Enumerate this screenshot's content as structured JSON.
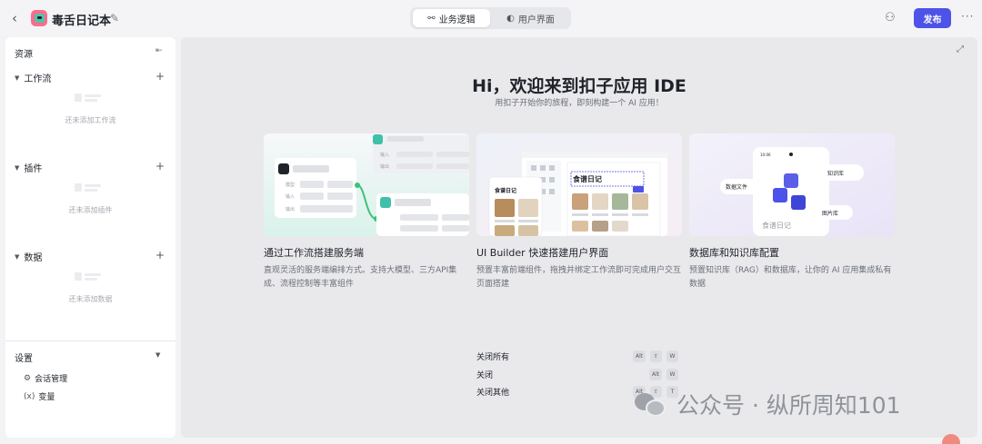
{
  "header": {
    "app_name": "毒舌日记本",
    "tabs": [
      {
        "label": "业务逻辑",
        "active": true
      },
      {
        "label": "用户界面",
        "active": false
      }
    ],
    "publish_label": "发布"
  },
  "sidebar": {
    "title": "资源",
    "sections": [
      {
        "title": "工作流",
        "empty_text": "还未添加工作流"
      },
      {
        "title": "插件",
        "empty_text": "还未添加插件"
      },
      {
        "title": "数据",
        "empty_text": "还未添加数据"
      }
    ],
    "settings": {
      "title": "设置",
      "items": [
        {
          "label": "会话管理",
          "icon": "session-icon"
        },
        {
          "label": "变量",
          "icon": "variable-icon"
        }
      ]
    }
  },
  "main": {
    "headline": "Hi，欢迎来到扣子应用 IDE",
    "subline": "用扣子开始你的旅程，即刻构建一个 AI 应用！",
    "cards": [
      {
        "title": "通过工作流搭建服务端",
        "desc": "直观灵活的服务端编排方式。支持大模型、三方API集成、流程控制等丰富组件",
        "illustration": {
          "labels": [
            "输入",
            "输出",
            "模型",
            "输入",
            "输出"
          ]
        }
      },
      {
        "title": "UI Builder 快速搭建用户界面",
        "desc": "预置丰富前端组件，拖拽并绑定工作流即可完成用户交互页面搭建",
        "illustration": {
          "labels": [
            "食谱日记",
            "食谱日记"
          ]
        }
      },
      {
        "title": "数据库和知识库配置",
        "desc": "预置知识库（RAG）和数据库，让你的 AI 应用集成私有数据",
        "illustration": {
          "labels": [
            "数据文件",
            "知识库",
            "图片库",
            "食谱日记",
            "10:06"
          ]
        }
      }
    ],
    "shortcuts": [
      {
        "label": "关闭所有",
        "keys": [
          "Alt",
          "⇧",
          "W"
        ]
      },
      {
        "label": "关闭",
        "keys": [
          "Alt",
          "W"
        ]
      },
      {
        "label": "关闭其他",
        "keys": [
          "Alt",
          "⇧",
          "T"
        ]
      }
    ]
  },
  "watermark": "公众号 · 纵所周知101",
  "colors": {
    "accent": "#4d53e8",
    "workflow_green": "#3cc27a",
    "app_icon": "#ff6b8a"
  }
}
